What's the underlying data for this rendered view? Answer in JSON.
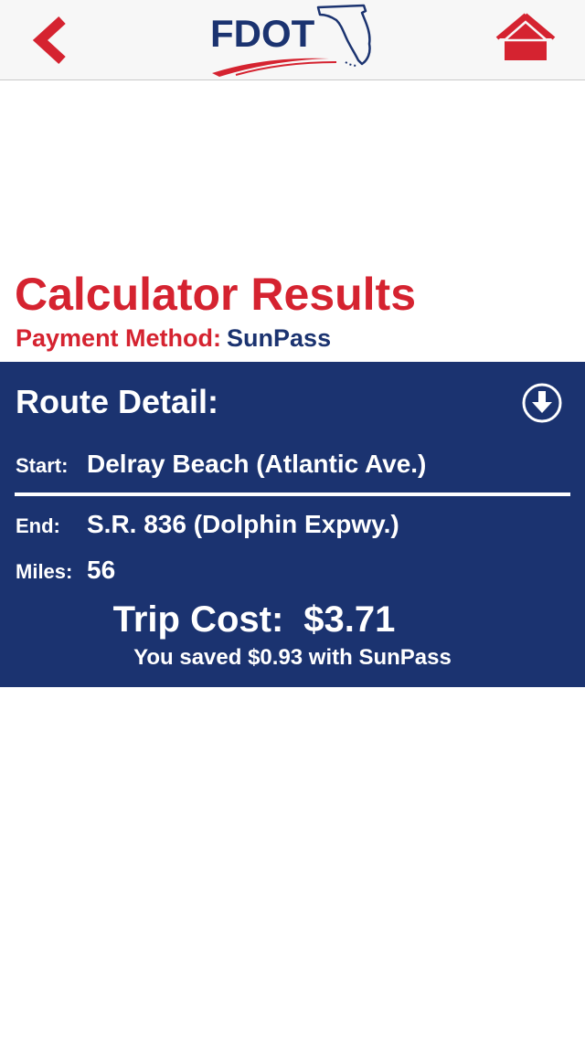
{
  "colors": {
    "brand_red": "#d52330",
    "brand_navy": "#1b3370",
    "navbar_bg": "#f7f7f7",
    "text_white": "#ffffff"
  },
  "navbar": {
    "back_icon": "chevron-left-icon",
    "home_icon": "home-icon",
    "logo_text": "FDOT"
  },
  "results": {
    "title": "Calculator Results",
    "payment_label": "Payment Method:",
    "payment_value": "SunPass"
  },
  "route": {
    "heading": "Route Detail:",
    "download_icon": "download-circle-icon",
    "start_label": "Start:",
    "start_value": "Delray Beach (Atlantic Ave.)",
    "end_label": "End:",
    "end_value": "S.R. 836 (Dolphin Expwy.)",
    "miles_label": "Miles:",
    "miles_value": "56",
    "trip_cost_label": "Trip Cost:",
    "trip_cost_value": "$3.71",
    "savings_text": "You saved $0.93 with SunPass"
  }
}
